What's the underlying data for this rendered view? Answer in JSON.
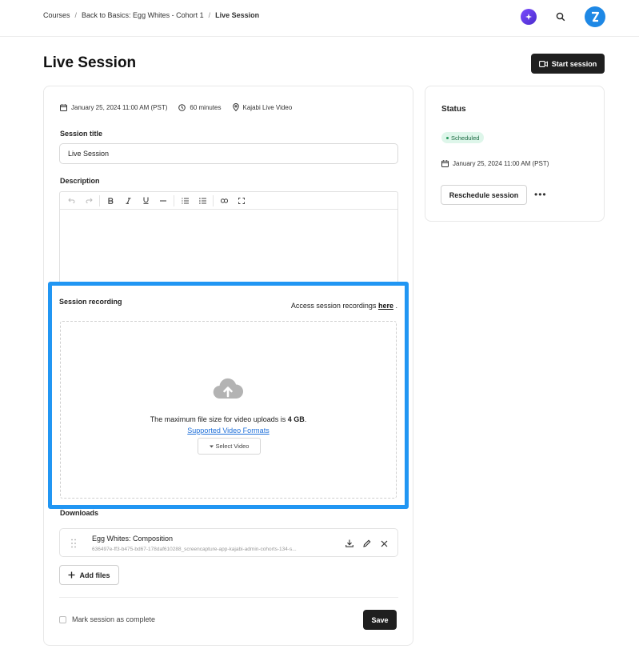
{
  "breadcrumb": {
    "items": [
      "Courses",
      "Back to Basics: Egg Whites - Cohort 1",
      "Live Session"
    ],
    "separator": "/"
  },
  "header": {
    "title": "Live Session",
    "start_button": "Start session"
  },
  "session": {
    "date": "January 25, 2024 11:00 AM (PST)",
    "duration": "60 minutes",
    "location": "Kajabi Live Video",
    "title_label": "Session title",
    "title_value": "Live Session",
    "description_label": "Description"
  },
  "recording": {
    "label": "Session recording",
    "access_prefix": "Access session recordings",
    "access_link": "here",
    "access_suffix": ".",
    "max_size_prefix": "The maximum file size for video uploads is",
    "max_size_value": "4 GB",
    "max_size_suffix": ".",
    "formats_link": "Supported Video Formats",
    "select_button": "Select Video"
  },
  "downloads": {
    "label": "Downloads",
    "items": [
      {
        "name": "Egg Whites: Composition",
        "file": "636497e-ff3-b475-bd67-178daf610288_screencapture-app-kajabi-admin-cohorts-134-s..."
      }
    ],
    "add_button": "Add files"
  },
  "footer": {
    "complete_label": "Mark session as complete",
    "save_button": "Save"
  },
  "status": {
    "title": "Status",
    "badge": "Scheduled",
    "date": "January 25, 2024 11:00 AM (PST)",
    "reschedule_button": "Reschedule session",
    "more_label": "•••"
  },
  "colors": {
    "accent": "#2196f3",
    "dark_button": "#1f1f1f",
    "badge_bg": "#def6ea",
    "link": "#1e6fd9"
  }
}
